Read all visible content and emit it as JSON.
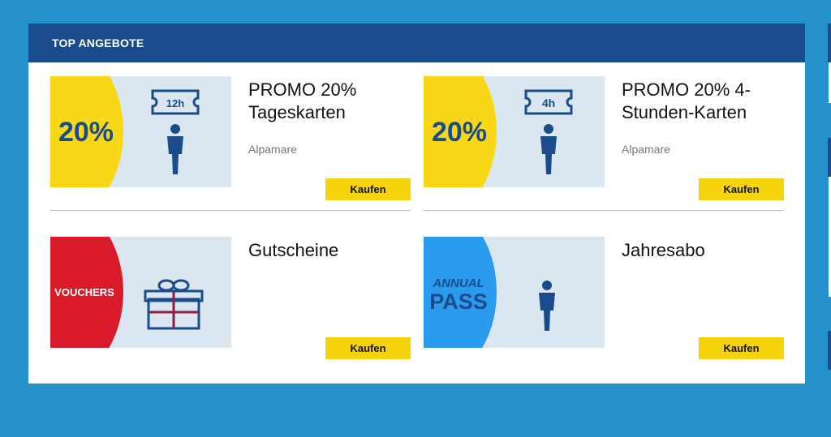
{
  "header": {
    "title": "TOP ANGEBOTE"
  },
  "offers": [
    {
      "title": "PROMO 20% Tageskarten",
      "subtitle": "Alpamare",
      "buy_label": "Kaufen",
      "badge": "20%",
      "ticket_label": "12h",
      "icon": "person-icon"
    },
    {
      "title": "PROMO 20% 4-Stunden-Karten",
      "subtitle": "Alpamare",
      "buy_label": "Kaufen",
      "badge": "20%",
      "ticket_label": "4h",
      "icon": "person-icon"
    },
    {
      "title": "Gutscheine",
      "subtitle": "",
      "buy_label": "Kaufen",
      "badge": "VOUCHERS",
      "icon": "gift-icon"
    },
    {
      "title": "Jahresabo",
      "subtitle": "",
      "buy_label": "Kaufen",
      "badge_line1": "ANNUAL",
      "badge_line2": "PASS",
      "icon": "person-icon"
    }
  ],
  "colors": {
    "background": "#2591cc",
    "header": "#1a4c8b",
    "button": "#f5d40d",
    "promo_yellow": "#f7d716",
    "voucher_red": "#d91a2a",
    "pass_blue": "#2b9bf0",
    "thumb_bg": "#dbe7f0"
  }
}
